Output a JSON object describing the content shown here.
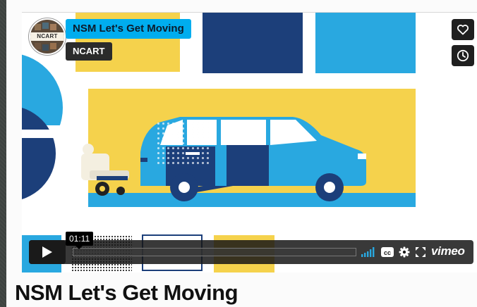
{
  "video": {
    "title_badge": "NSM Let's Get Moving",
    "byline": "NCART",
    "avatar_text": "NCART",
    "current_time": "01:11",
    "brand": "vimeo"
  },
  "page": {
    "heading": "NSM Let's Get Moving"
  },
  "icons": {
    "like": "heart-icon",
    "watch_later": "clock-icon",
    "play": "play-icon",
    "volume": "volume-bars-icon",
    "captions": "cc-icon",
    "settings": "gear-icon",
    "fullscreen": "fullscreen-icon"
  },
  "colors": {
    "accent_blue": "#00adef",
    "sky_blue": "#29a8e0",
    "navy": "#1c3f7a",
    "yellow": "#f5d24c"
  }
}
